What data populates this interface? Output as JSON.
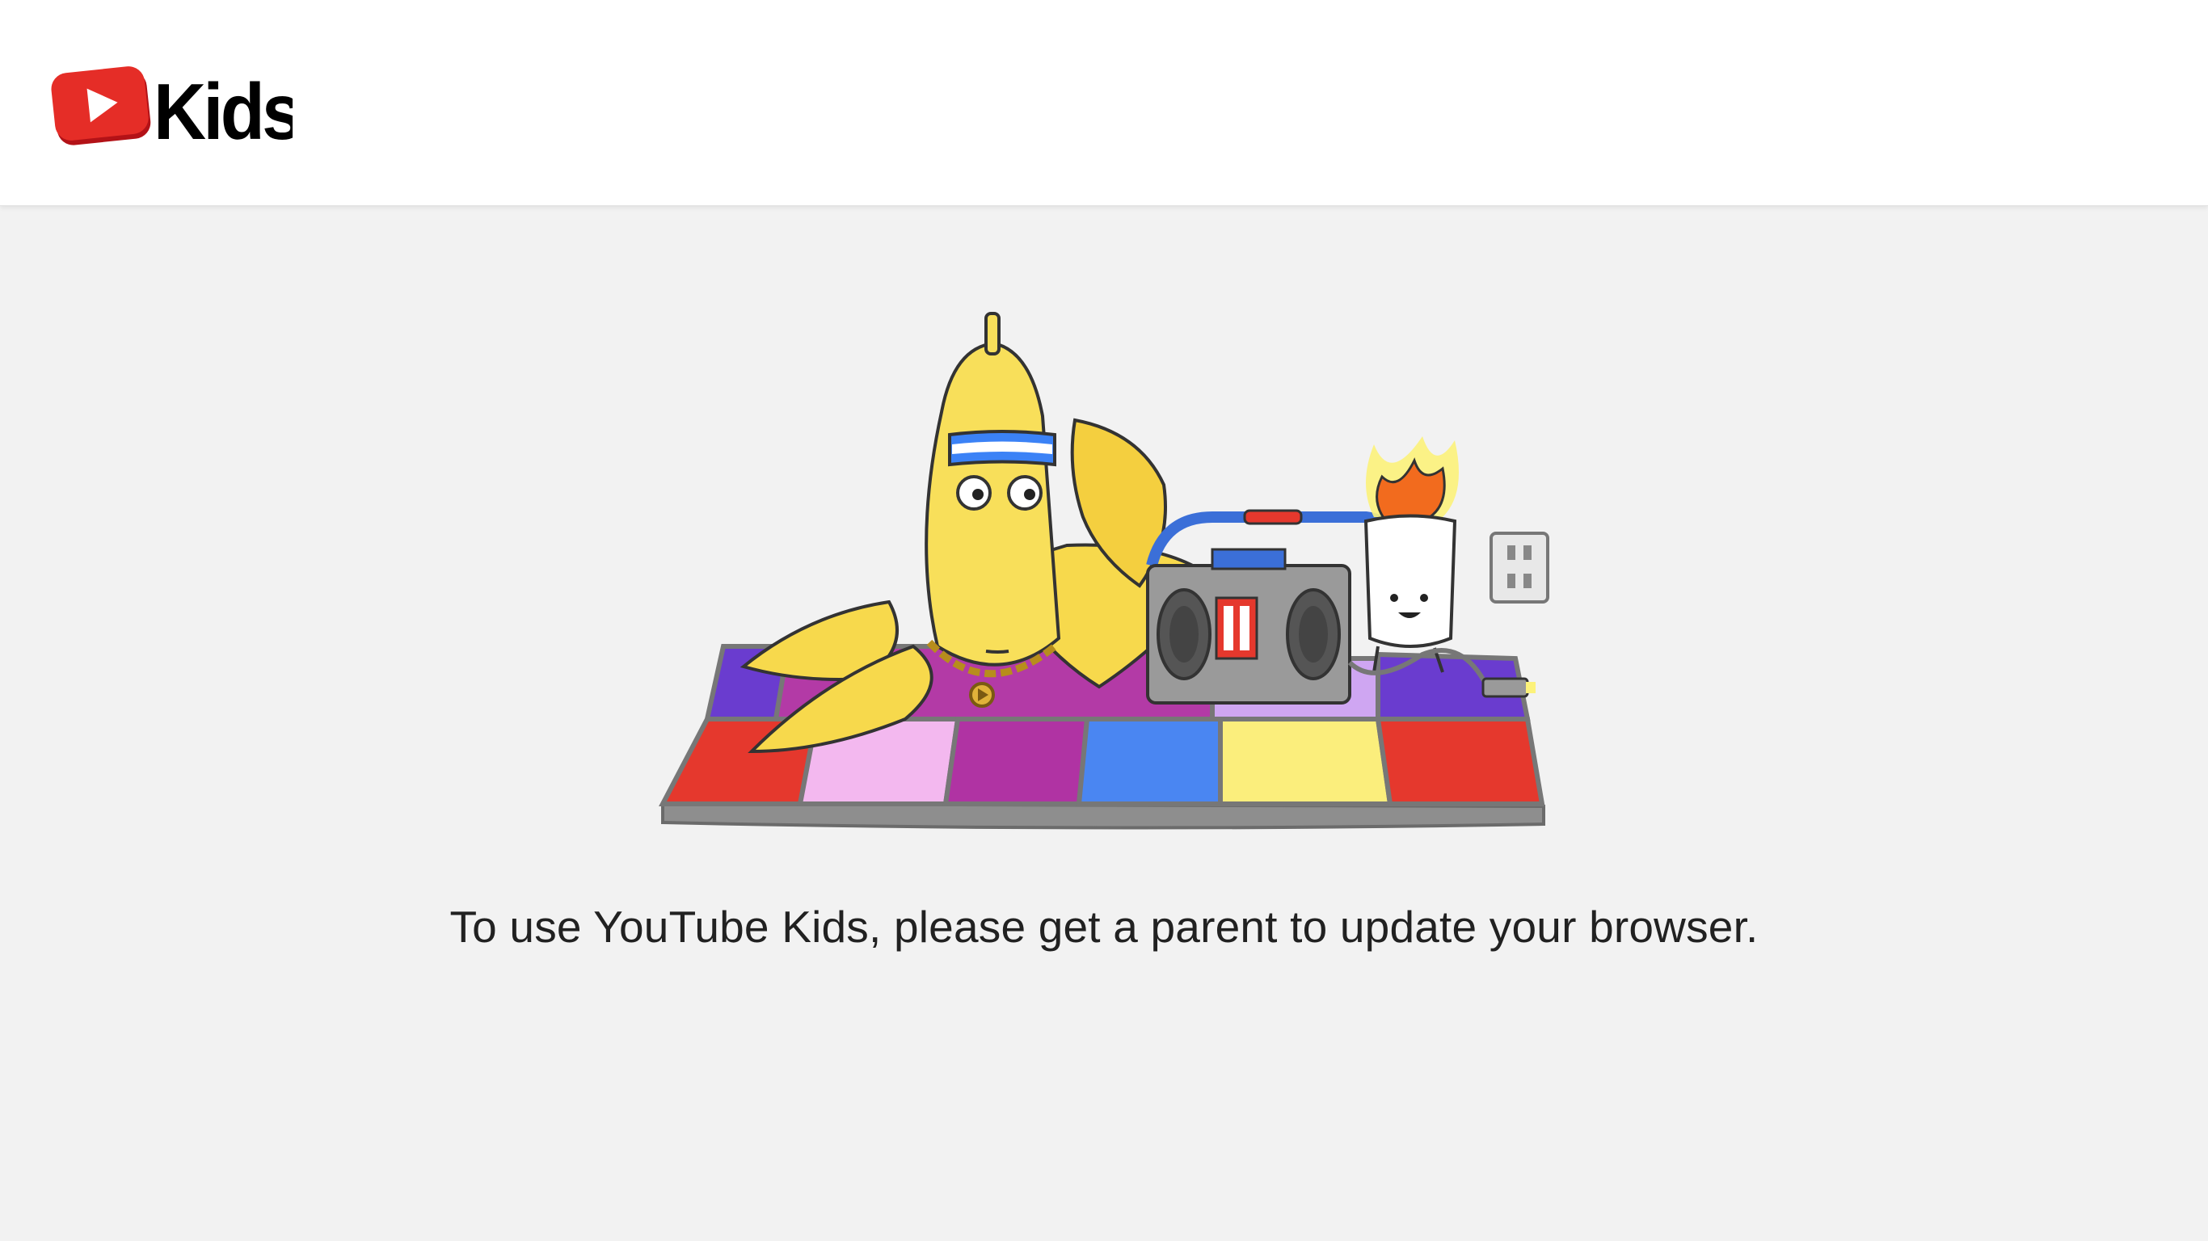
{
  "header": {
    "logo_icon": "youtube-play-icon",
    "logo_text": "Kids",
    "logo_colors": {
      "badge": "#e52d27",
      "badge_shadow": "#b31217",
      "play": "#ffffff",
      "text": "#000000"
    }
  },
  "main": {
    "illustration_icon": "banana-dance-floor-illustration",
    "message": "To use YouTube Kids, please get a parent to update your browser."
  },
  "colors": {
    "page_background": "#f2f2f2",
    "header_background": "#ffffff",
    "message_text": "#212121"
  }
}
